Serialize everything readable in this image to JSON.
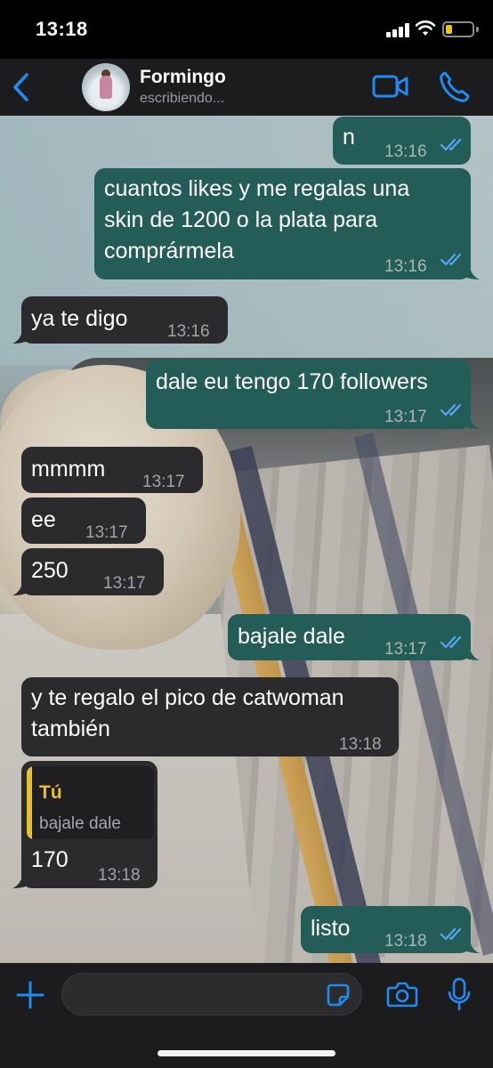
{
  "status_bar": {
    "time": "13:18"
  },
  "header": {
    "contact_name": "Formingo",
    "contact_status": "escribiendo...",
    "accent_color": "#1f8cf0"
  },
  "messages": [
    {
      "direction": "outgoing",
      "text": "n",
      "time": "13:16",
      "read": true
    },
    {
      "direction": "outgoing",
      "lines": [
        "cuantos likes y me regalas una",
        "skin de 1200 o la plata para",
        "comprármela"
      ],
      "time": "13:16",
      "read": true
    },
    {
      "direction": "incoming",
      "text": "ya te digo",
      "time": "13:16"
    },
    {
      "direction": "outgoing",
      "text": "dale eu tengo 170 followers",
      "time": "13:17",
      "read": true
    },
    {
      "direction": "incoming",
      "text": "mmmm",
      "time": "13:17"
    },
    {
      "direction": "incoming",
      "text": "ee",
      "time": "13:17"
    },
    {
      "direction": "incoming",
      "text": "250",
      "time": "13:17"
    },
    {
      "direction": "outgoing",
      "text": "bajale dale",
      "time": "13:17",
      "read": true
    },
    {
      "direction": "incoming",
      "lines": [
        "y te regalo el pico de catwoman",
        "también"
      ],
      "time": "13:18"
    },
    {
      "direction": "incoming",
      "quote": {
        "author": "Tú",
        "text": "bajale dale"
      },
      "text": "170",
      "time": "13:18"
    },
    {
      "direction": "outgoing",
      "text": "listo",
      "time": "13:18",
      "read": true
    }
  ],
  "input_bar": {
    "placeholder": ""
  },
  "colors": {
    "outgoing_bubble": "#245c58",
    "incoming_bubble": "#2b2b2d",
    "read_ticks": "#53a8f5",
    "quote_accent": "#e6c233"
  },
  "icons": [
    "back-chevron-icon",
    "video-camera-icon",
    "phone-icon",
    "plus-icon",
    "sticker-icon",
    "camera-icon",
    "microphone-icon",
    "double-check-icon"
  ]
}
